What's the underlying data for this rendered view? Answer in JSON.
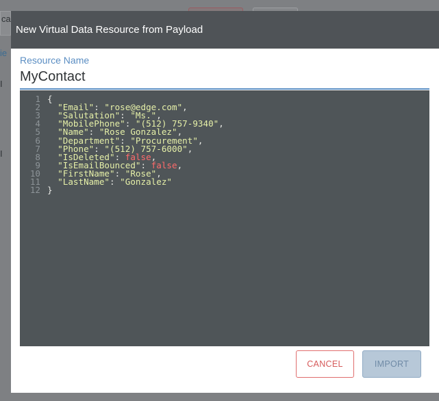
{
  "background": {
    "input_partial_text": "ca",
    "marks": [
      {
        "text": "ie",
        "style": "link"
      },
      {
        "text": "I",
        "style": "dark"
      },
      {
        "text": "I",
        "style": "dark"
      }
    ]
  },
  "modal": {
    "title": "New Virtual Data Resource from Payload",
    "resource_name_label": "Resource Name",
    "resource_name_value": "MyContact",
    "code_lines": [
      {
        "n": "1",
        "key": "",
        "sep": "",
        "val": "",
        "val_type": "",
        "text": "{"
      },
      {
        "n": "2",
        "key": "\"Email\"",
        "sep": ": ",
        "val": "\"rose@edge.com\"",
        "val_type": "str",
        "text": ","
      },
      {
        "n": "3",
        "key": "\"Salutation\"",
        "sep": ": ",
        "val": "\"Ms.\"",
        "val_type": "str",
        "text": ","
      },
      {
        "n": "4",
        "key": "\"MobilePhone\"",
        "sep": ": ",
        "val": "\"(512) 757-9340\"",
        "val_type": "str",
        "text": ","
      },
      {
        "n": "5",
        "key": "\"Name\"",
        "sep": ": ",
        "val": "\"Rose Gonzalez\"",
        "val_type": "str",
        "text": ","
      },
      {
        "n": "6",
        "key": "\"Department\"",
        "sep": ": ",
        "val": "\"Procurement\"",
        "val_type": "str",
        "text": ","
      },
      {
        "n": "7",
        "key": "\"Phone\"",
        "sep": ": ",
        "val": "\"(512) 757-6000\"",
        "val_type": "str",
        "text": ","
      },
      {
        "n": "8",
        "key": "\"IsDeleted\"",
        "sep": ": ",
        "val": "false",
        "val_type": "bool",
        "text": ","
      },
      {
        "n": "9",
        "key": "\"IsEmailBounced\"",
        "sep": ": ",
        "val": "false",
        "val_type": "bool",
        "text": ","
      },
      {
        "n": "10",
        "key": "\"FirstName\"",
        "sep": ": ",
        "val": "\"Rose\"",
        "val_type": "str",
        "text": ","
      },
      {
        "n": "11",
        "key": "\"LastName\"",
        "sep": ": ",
        "val": "\"Gonzalez\"",
        "val_type": "str",
        "text": ""
      },
      {
        "n": "12",
        "key": "",
        "sep": "",
        "val": "",
        "val_type": "",
        "text": "}"
      }
    ],
    "buttons": {
      "cancel": "CANCEL",
      "import": "IMPORT"
    }
  },
  "colors": {
    "header_bg": "#4f5357",
    "editor_bg": "#4f5558",
    "string": "#e6f0a8",
    "boolean": "#ff6b6b",
    "accent": "#5b8ec3",
    "cancel": "#d65a5a"
  }
}
